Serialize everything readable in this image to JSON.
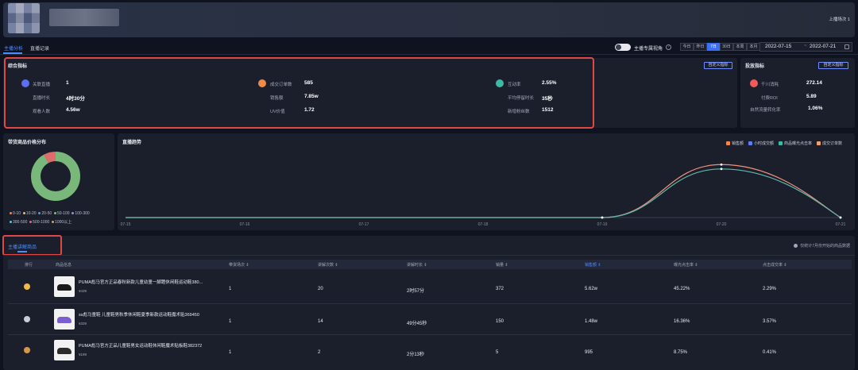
{
  "header": {
    "stream_count": "上播场次 1"
  },
  "tabs": [
    "主播分析",
    "直播记录"
  ],
  "filters": {
    "toggle_label": "主播专属视角",
    "ranges": [
      "今日",
      "昨日",
      "7日",
      "30日",
      "本周",
      "本月"
    ],
    "active_range": "7日",
    "date_start": "2022-07-15",
    "date_sep": "~",
    "date_end": "2022-07-21"
  },
  "metrics": {
    "title": "综合指标",
    "custom_btn": "自定义指标",
    "groups": [
      {
        "icon": "live-icon",
        "color": "#5b6ef5",
        "rows": [
          [
            "关联直播",
            "1"
          ],
          [
            "直播时长",
            "4时30分"
          ],
          [
            "观看人数",
            "4.56w"
          ]
        ]
      },
      {
        "icon": "order-icon",
        "color": "#f08a4b",
        "rows": [
          [
            "成交订单数",
            "585"
          ],
          [
            "销售额",
            "7.85w"
          ],
          [
            "UV价值",
            "1.72"
          ]
        ]
      },
      {
        "icon": "interaction-icon",
        "color": "#3fb9a3",
        "rows": [
          [
            "互动率",
            "2.55%"
          ],
          [
            "平均停留时长",
            "35秒"
          ],
          [
            "新增粉丝数",
            "1512"
          ]
        ]
      }
    ]
  },
  "ad_metrics": {
    "title": "投放指标",
    "custom_btn": "自定义指标",
    "color": "#f05a5a",
    "rows": [
      [
        "千川消耗",
        "272.14"
      ],
      [
        "付费ROI",
        "5.89"
      ],
      [
        "自然流量转化率",
        "1.06%"
      ]
    ]
  },
  "price_dist": {
    "title": "带货商品价格分布",
    "legend": [
      "0-10",
      "10-20",
      "20-50",
      "50-100",
      "100-300",
      "300-500",
      "500-1000",
      "1000以上"
    ],
    "legend_colors": [
      "#f08a4b",
      "#e8c24a",
      "#5b9bd5",
      "#7fbf7f",
      "#a58ad8",
      "#5fc3d6",
      "#e06b8b",
      "#c8a46e"
    ],
    "slices": [
      {
        "label": "100-300",
        "value": 92,
        "color": "#79b87a"
      },
      {
        "label": "300-500",
        "value": 8,
        "color": "#e06b6b"
      }
    ]
  },
  "trend": {
    "title": "直播趋势",
    "legend": [
      {
        "name": "销售额",
        "color": "#f08a4b"
      },
      {
        "name": "小时成交额",
        "color": "#5b7ef5"
      },
      {
        "name": "商品曝光点击率",
        "color": "#3fb9a3"
      },
      {
        "name": "成交订单数",
        "color": "#f0a070"
      }
    ]
  },
  "chart_data": {
    "type": "line",
    "title": "直播趋势",
    "x": [
      "07-15",
      "07-16",
      "07-17",
      "07-18",
      "07-19",
      "07-20",
      "07-21"
    ],
    "series": [
      {
        "name": "销售额",
        "values": [
          0,
          0,
          0,
          0,
          0,
          78500,
          0
        ]
      },
      {
        "name": "商品曝光点击率",
        "values": [
          0,
          0,
          0,
          0,
          0,
          72000,
          0
        ]
      }
    ],
    "ylim": [
      0,
      100000
    ],
    "grid": false,
    "legend_position": "top-right"
  },
  "table": {
    "tab_label": "主播讲解商品",
    "hint": "仅统计7月份开始的商品数据",
    "columns": [
      "排行",
      "商品信息",
      "带货场次 ⇕",
      "讲解次数 ⇕",
      "讲解时长 ⇕",
      "销量 ⇕",
      "销售额 ⇕",
      "曝光点击率 ⇕",
      "点击成交率 ⇕"
    ],
    "rows": [
      {
        "medal": "#f0b94a",
        "name": "PUMA彪马官方正品春秋新款儿童幼童一脚蹬休闲鞋运动鞋380...",
        "price": "¥439",
        "sessions": "1",
        "explains": "20",
        "duration": "2时57分",
        "sales": "372",
        "revenue": "5.62w",
        "ctr": "45.22%",
        "cvr": "2.29%",
        "thumb": "#1b1b1b"
      },
      {
        "medal": "#c8ccd8",
        "name": "ss彪马童鞋 儿童鞋男秋季休闲鞋夏季新款运动鞋魔术贴369450",
        "price": "¥339",
        "sessions": "1",
        "explains": "14",
        "duration": "49分45秒",
        "sales": "150",
        "revenue": "1.48w",
        "ctr": "16.36%",
        "cvr": "3.57%",
        "thumb": "#7a5fd0"
      },
      {
        "medal": "#d9964a",
        "name": "PUMA彪马官方正品儿童鞋男女运动鞋休闲鞋魔术贴板鞋382372",
        "price": "¥199",
        "sessions": "1",
        "explains": "2",
        "duration": "2分13秒",
        "sales": "5",
        "revenue": "995",
        "ctr": "8.75%",
        "cvr": "0.41%",
        "thumb": "#2b2b2b"
      }
    ]
  }
}
